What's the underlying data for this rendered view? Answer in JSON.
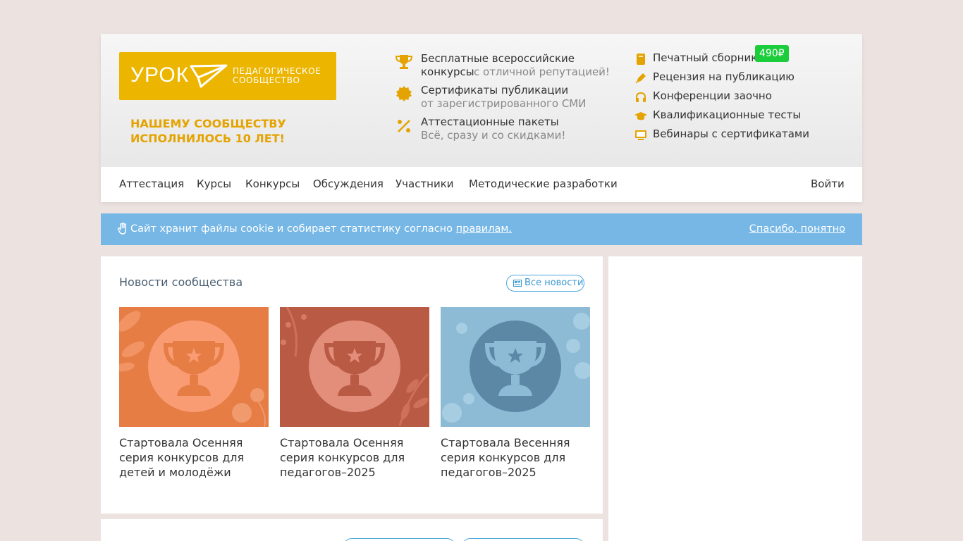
{
  "header": {
    "logo": {
      "word": "УРОК",
      "sub_line1": "ПЕДАГОГИЧЕСКОЕ",
      "sub_line2": "СООБЩЕСТВО"
    },
    "anniversary_line1": "НАШЕМУ СООБЩЕСТВУ",
    "anniversary_line2": "ИСПОЛНИЛОСЬ 10 ЛЕТ!",
    "features": [
      {
        "icon": "trophy-icon",
        "title": "Бесплатные всероссийские",
        "title2": "конкурсы",
        "sub": "с отличной репутацией!"
      },
      {
        "icon": "seal-icon",
        "title": "Сертификаты публикации",
        "sub": "от зарегистрированного СМИ"
      },
      {
        "icon": "percent-icon",
        "title": "Аттестационные пакеты",
        "sub": "Всё, сразу и со скидками!"
      }
    ],
    "side_links": [
      {
        "icon": "book-icon",
        "label": "Печатный сборник",
        "badge": "490₽"
      },
      {
        "icon": "pen-icon",
        "label": "Рецензия на публикацию"
      },
      {
        "icon": "headphones-icon",
        "label": "Конференции заочно"
      },
      {
        "icon": "graduation-cap-icon",
        "label": "Квалификационные тесты"
      },
      {
        "icon": "monitor-icon",
        "label": "Вебинары с сертификатами"
      }
    ],
    "accent_color": "#ecb500"
  },
  "nav": {
    "items": [
      "Аттестация",
      "Курсы",
      "Конкурсы",
      "Обсуждения",
      "Участники",
      "Методические разработки"
    ],
    "login": "Войти"
  },
  "cookie": {
    "text": "Сайт хранит файлы cookie и собирает статистику согласно",
    "link": "правилам.",
    "ok": "Спасибо, понятно",
    "bg_color": "#76b7e6"
  },
  "news": {
    "title": "Новости сообщества",
    "all_news": "Все новости",
    "cards": [
      {
        "title": "Стартовала Осенняя серия конкурсов для детей и молодёжи"
      },
      {
        "title": "Стартовала Осенняя серия конкурсов для педагогов–2025"
      },
      {
        "title": "Стартовала Весенняя серия конкурсов для педагогов–2025"
      }
    ]
  }
}
